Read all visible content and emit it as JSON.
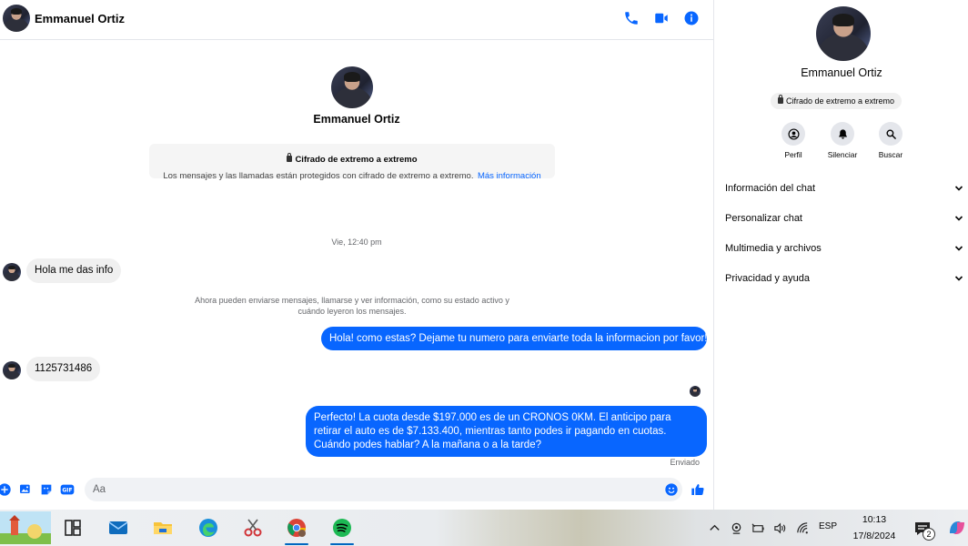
{
  "contact": {
    "name": "Emmanuel Ortiz"
  },
  "encryption": {
    "title": "Cifrado de extremo a extremo",
    "description": "Los mensajes y las llamadas están protegidos con cifrado de extremo a extremo.",
    "link": "Más información"
  },
  "conversation": {
    "timestamp": "Vie, 12:40 pm",
    "system_note": "Ahora pueden enviarse mensajes, llamarse y ver información, como su estado activo y cuándo leyeron los mensajes.",
    "messages": [
      {
        "direction": "in",
        "text": "Hola me das info"
      },
      {
        "direction": "out",
        "text": "Hola! como estas? Dejame tu numero para enviarte toda la informacion por favor!"
      },
      {
        "direction": "in",
        "text": "1125731486"
      },
      {
        "direction": "out",
        "text": "Perfecto! La cuota desde $197.000 es de un CRONOS 0KM. El anticipo para retirar el auto es de $7.133.400, mientras tanto podes ir pagando en cuotas. Cuándo podes hablar? A la mañana o a la tarde?"
      }
    ],
    "sent_status": "Enviado"
  },
  "composer": {
    "placeholder": "Aa"
  },
  "details": {
    "e2e_label": "Cifrado de extremo a extremo",
    "actions": [
      {
        "label": "Perfil",
        "icon": "profile-icon"
      },
      {
        "label": "Silenciar",
        "icon": "bell-icon"
      },
      {
        "label": "Buscar",
        "icon": "search-icon"
      }
    ],
    "sections": [
      {
        "label": "Información del chat"
      },
      {
        "label": "Personalizar chat"
      },
      {
        "label": "Multimedia y archivos"
      },
      {
        "label": "Privacidad y ayuda"
      }
    ]
  },
  "taskbar": {
    "language": "ESP",
    "time": "10:13",
    "date": "17/8/2024",
    "notification_count": "2"
  },
  "colors": {
    "accent": "#0866ff",
    "bubble_in": "#f0f0f0"
  }
}
